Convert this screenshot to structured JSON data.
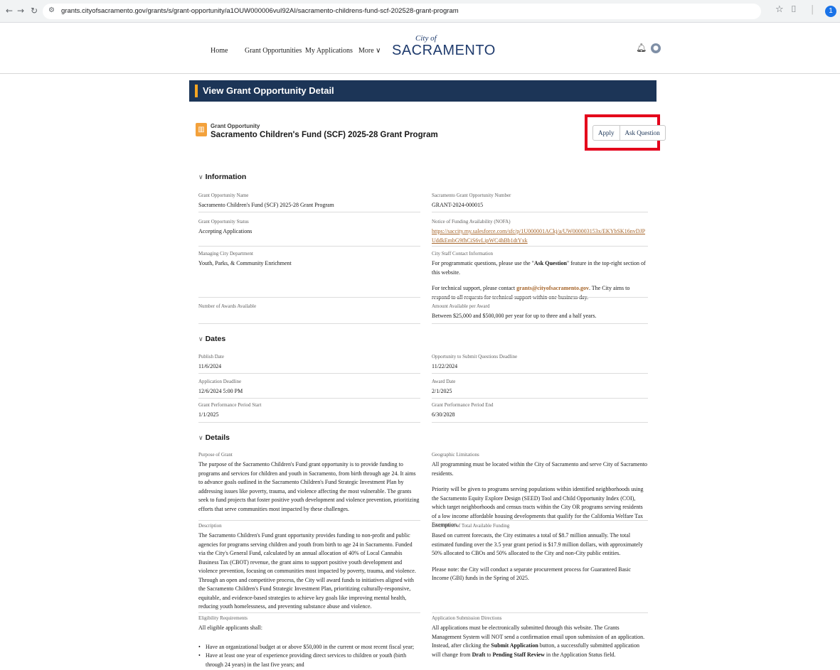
{
  "browser": {
    "url": "grants.cityofsacramento.gov/grants/s/grant-opportunity/a1OUW000006vuI92AI/sacramento-childrens-fund-scf-202528-grant-program",
    "profile_initial": "1"
  },
  "nav": {
    "home": "Home",
    "grant_opportunities": "Grant Opportunities",
    "my_applications": "My Applications",
    "more": "More",
    "logo_small": "City of",
    "logo_main": "SACRAMENTO"
  },
  "banner": {
    "title": "View Grant Opportunity Detail"
  },
  "record": {
    "type": "Grant Opportunity",
    "name": "Sacramento Children's Fund (SCF) 2025-28 Grant Program",
    "apply": "Apply",
    "ask_question": "Ask Question"
  },
  "information": {
    "heading": "Information",
    "name_label": "Grant Opportunity Name",
    "name_value": "Sacramento Children's Fund (SCF) 2025-28 Grant Program",
    "number_label": "Sacramento Grant Opportunity Number",
    "number_value": "GRANT-2024-000015",
    "status_label": "Grant Opportunity Status",
    "status_value": "Accepting Applications",
    "nofa_label": "Notice of Funding Availability (NOFA)",
    "nofa_link": "https://saccity.my.salesforce.com/sfc/p/1U000001ACkj/a/UW000003153x/EKYbSK16nvDJPUddkEmbG9fhCiS6vLipWC4hBb1dtYxk",
    "dept_label": "Managing City Department",
    "dept_value": "Youth, Parks, & Community Enrichment",
    "contact_label": "City Staff Contact Information",
    "contact_p1_a": "For programmatic questions, please use the \"",
    "contact_p1_b": "Ask Question",
    "contact_p1_c": "\" feature in the top-right section of this website.",
    "contact_p2_a": "For technical support, please contact ",
    "contact_p2_email": "grants@cityofsacramento.gov",
    "contact_p2_b": ". The City aims to respond to all requests for technical support within one business day.",
    "awards_label": "Number of Awards Available",
    "amount_label": "Amount Available per Award",
    "amount_value": "Between $25,000 and $500,000 per year for up to three and a half years."
  },
  "dates": {
    "heading": "Dates",
    "publish_label": "Publish Date",
    "publish_value": "11/6/2024",
    "questions_label": "Opportunity to Submit Questions Deadline",
    "questions_value": "11/22/2024",
    "deadline_label": "Application Deadline",
    "deadline_value": "12/6/2024 5:00 PM",
    "award_label": "Award Date",
    "award_value": "2/1/2025",
    "start_label": "Grant Performance Period Start",
    "start_value": "1/1/2025",
    "end_label": "Grant Performance Period End",
    "end_value": "6/30/2028"
  },
  "details": {
    "heading": "Details",
    "purpose_label": "Purpose of Grant",
    "purpose_value": "The purpose of the Sacramento Children's Fund grant opportunity is to provide funding to programs and services for children and youth in Sacramento, from birth through age 24. It aims to advance goals outlined in the Sacramento Children's Fund Strategic Investment Plan by addressing issues like poverty, trauma, and violence affecting the most vulnerable. The grants seek to fund projects that foster positive youth development and violence prevention, prioritizing efforts that serve communities most impacted by these challenges.",
    "geo_label": "Geographic Limitations",
    "geo_p1": "All programming must be located within the City of Sacramento and serve City of Sacramento residents.",
    "geo_p2": "Priority will be given to programs serving populations within identified neighborhoods using the Sacramento Equity Explore Design (SEED) Tool and Child Opportunity Index (COI), which target neighborhoods and census tracts within the City OR programs serving residents of a low income affordable housing developments that qualify for the California Welfare Tax Exemption.",
    "desc_label": "Description",
    "desc_value": "The Sacramento Children's Fund grant opportunity provides funding to non-profit and public agencies for programs serving children and youth from birth to age 24 in Sacramento. Funded via the City's General Fund, calculated by an annual allocation of 40% of Local Cannabis Business Tax (CBOT) revenue, the grant aims to support positive youth development and violence prevention, focusing on communities most impacted by poverty, trauma, and violence. Through an open and competitive process, the City will award funds to initiatives aligned with the Sacramento Children's Fund Strategic Investment Plan, prioritizing culturally-responsive, equitable, and evidence-based strategies to achieve key goals like improving mental health, reducing youth homelessness, and preventing substance abuse and violence.",
    "funding_label": "Description of Total Available Funding",
    "funding_p1": "Based on current forecasts, the City estimates a total of $8.7 million annually. The total estimated funding over the 3.5 year grant period is $17.9 million dollars, with approximately 50% allocated to CBOs and 50% allocated to the City and non-City public entities.",
    "funding_p2": "Please note: the City will conduct a separate procurement process for Guaranteed Basic Income (GBI) funds in the Spring of 2025.",
    "elig_label": "Eligibility Requirements",
    "elig_intro": "All eligible applicants shall:",
    "elig_items": [
      "Have an organizational budget at or above $50,000 in the current or most recent fiscal year;",
      "Have at least one year of experience providing direct services to children or youth (birth through 24 years) in the last five years; and"
    ],
    "submit_label": "Application Submission Directions",
    "submit_a": "All applications must be electronically submitted through this website. The Grants Management System will NOT send a confirmation email upon submission of an application. Instead, after clicking the ",
    "submit_b": "Submit Application",
    "submit_c": " button, a successfully submitted application will change from ",
    "submit_d": "Draft",
    "submit_e": " to ",
    "submit_f": "Pending Staff Review",
    "submit_g": " in the Application Status field."
  }
}
